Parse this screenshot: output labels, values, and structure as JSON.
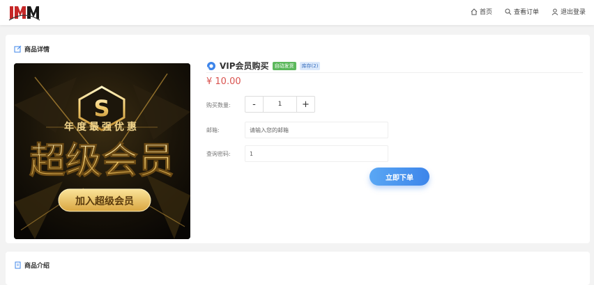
{
  "nav": {
    "home": "首页",
    "orders": "查看订单",
    "logout": "退出登录"
  },
  "details": {
    "section_title": "商品详情",
    "product_name": "VIP会员购买",
    "badge_auto": "自动发货",
    "badge_stock": "库存(2)",
    "price": "¥ 10.00",
    "quantity_label": "购买数量:",
    "quantity_value": "1",
    "minus": "-",
    "plus": "+",
    "email_label": "邮箱:",
    "email_placeholder": "请输入您的邮箱",
    "password_label": "查询密码:",
    "password_value": "1",
    "order_button": "立即下单"
  },
  "image": {
    "top_text": "年度最强优惠",
    "main_text": "超级会员",
    "button_text": "加入超级会员"
  },
  "intro": {
    "section_title": "商品介绍"
  },
  "colors": {
    "price": "#d9534f",
    "accent": "#3d85ea",
    "badge_auto": "#5cb85c"
  }
}
